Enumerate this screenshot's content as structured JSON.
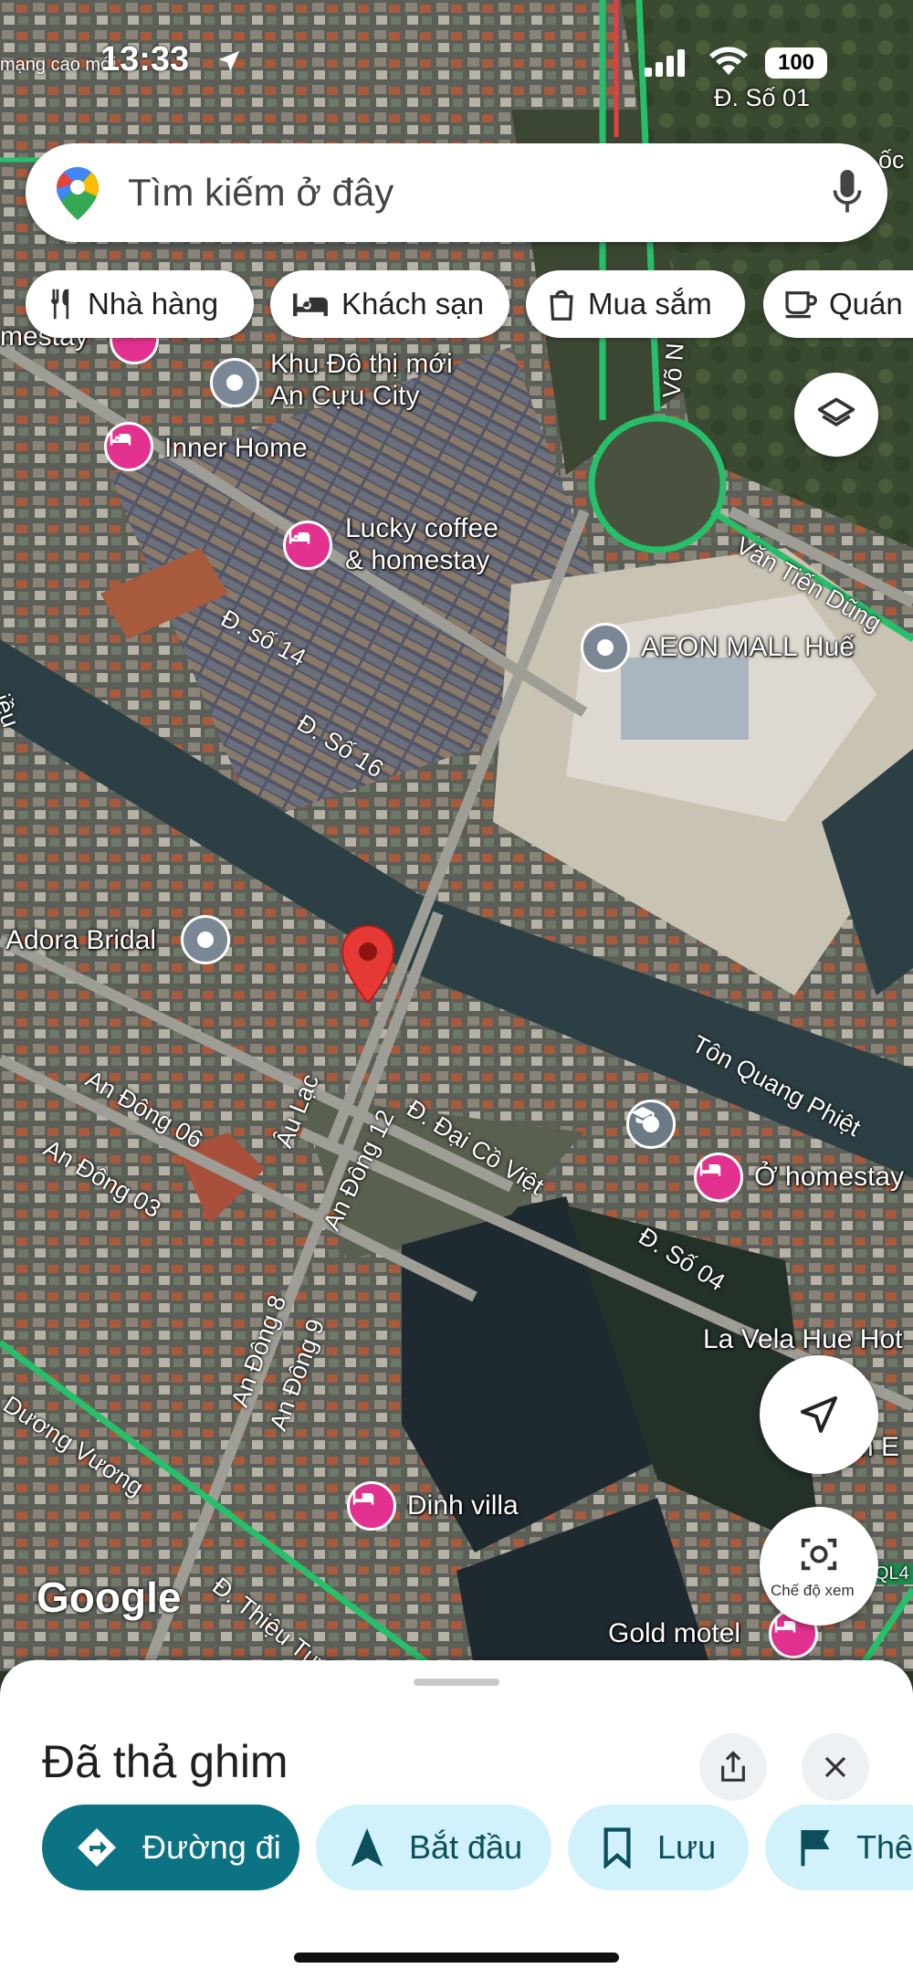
{
  "status_bar": {
    "time": "13:33",
    "carrier": "mạng cao mới",
    "battery": "100"
  },
  "search": {
    "placeholder": "Tìm kiếm ở đây"
  },
  "chips": [
    {
      "label": "Nhà hàng",
      "icon": "fork-knife-icon"
    },
    {
      "label": "Khách sạn",
      "icon": "bed-icon"
    },
    {
      "label": "Mua sắm",
      "icon": "shopping-bag-icon"
    },
    {
      "label": "Quán",
      "icon": "coffee-cup-icon"
    }
  ],
  "map": {
    "places": {
      "khu_do_thi_1": "Khu Đô thị mới",
      "khu_do_thi_2": "An Cựu City",
      "inner_home": "Inner Home",
      "lucky_1": "Lucky coffee",
      "lucky_2": "& homestay",
      "aeon": "AEON MALL Huế",
      "adora": "Adora Bridal",
      "o_homestay": "Ở homestay",
      "la_vela": "La Vela Hue Hot",
      "dinh_villa": "Dinh villa",
      "gold_motel": "Gold motel",
      "homestay_partial": "mestay",
      "hotel_partial": "h E",
      "stay_partial": "sta"
    },
    "roads": {
      "so_01": "Đ. Số 01",
      "van_tien_dung": "Văn Tiến Dũng",
      "so_14": "Đ. số 14",
      "so_16": "Đ. Số 16",
      "ton_quang_phiet": "Tôn Quang Phiệt",
      "dai_co_viet": "Đ. Đại Cồ Việt",
      "so_04": "Đ. Số 04",
      "au_lac": "Âu Lạc",
      "an_dong_12": "An Đông 12",
      "an_dong_06": "An Đông 06",
      "an_dong_03": "An Đông 03",
      "an_dong_8": "An Đông 8",
      "an_dong_9": "An Đông 9",
      "duong_vuong": "Dương Vương",
      "thieu_tuoc": "Đ. Thiệu Tước",
      "vo_nguyen": "Võ N",
      "ql4": "QL4",
      "oc": "ốc",
      "ieu": "iều"
    },
    "brand": "Google",
    "street_view_label": "Chế độ xem"
  },
  "sheet": {
    "title": "Đã thả ghim",
    "actions": [
      {
        "label": "Đường đi",
        "icon": "directions-icon"
      },
      {
        "label": "Bắt đầu",
        "icon": "navigation-arrow-icon"
      },
      {
        "label": "Lưu",
        "icon": "bookmark-icon"
      },
      {
        "label": "Thê",
        "icon": "flag-icon"
      }
    ]
  },
  "colors": {
    "hotel_pin": "#e3318f",
    "primary_button": "#0b7384",
    "secondary_button": "#d2f2fb",
    "dropped_pin": "#e53935",
    "highway": "#27c06a"
  }
}
